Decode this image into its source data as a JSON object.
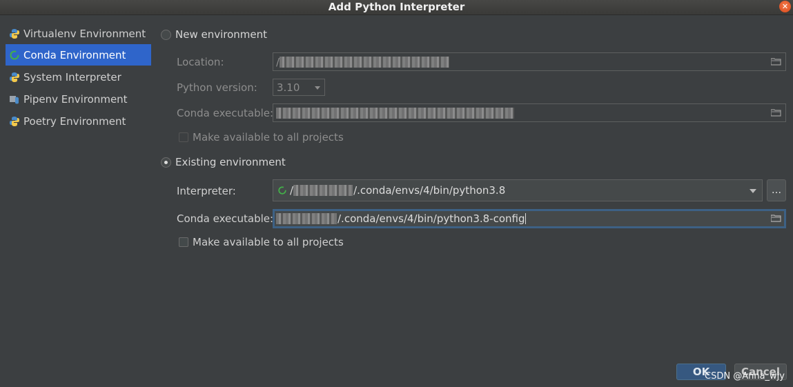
{
  "window": {
    "title": "Add Python Interpreter",
    "close_glyph": "✕"
  },
  "sidebar": {
    "items": [
      {
        "label": "Virtualenv Environment",
        "icon": "python-icon",
        "selected": false
      },
      {
        "label": "Conda Environment",
        "icon": "conda-icon",
        "selected": true
      },
      {
        "label": "System Interpreter",
        "icon": "python-icon",
        "selected": false
      },
      {
        "label": "Pipenv Environment",
        "icon": "pipenv-icon",
        "selected": false
      },
      {
        "label": "Poetry Environment",
        "icon": "poetry-icon",
        "selected": false
      }
    ]
  },
  "new_env": {
    "radio_label": "New environment",
    "selected": false,
    "location_label": "Location:",
    "location_value": "/",
    "python_version_label": "Python version:",
    "python_version_value": "3.10",
    "conda_exec_label": "Conda executable:",
    "make_available_label": "Make available to all projects",
    "make_available_checked": false
  },
  "existing_env": {
    "radio_label": "Existing environment",
    "selected": true,
    "interpreter_label": "Interpreter:",
    "interpreter_prefix": "/",
    "interpreter_value": "/.conda/envs/4/bin/python3.8",
    "browse_label": "...",
    "conda_exec_label": "Conda executable:",
    "conda_exec_value": "/.conda/envs/4/bin/python3.8-config",
    "make_available_label": "Make available to all projects",
    "make_available_checked": false
  },
  "footer": {
    "ok_label": "OK",
    "cancel_label": "Cancel",
    "watermark": "CSDN @Anna_wjy"
  },
  "colors": {
    "background": "#3c3f41",
    "selection": "#2f65ca",
    "ok_button": "#365880"
  }
}
